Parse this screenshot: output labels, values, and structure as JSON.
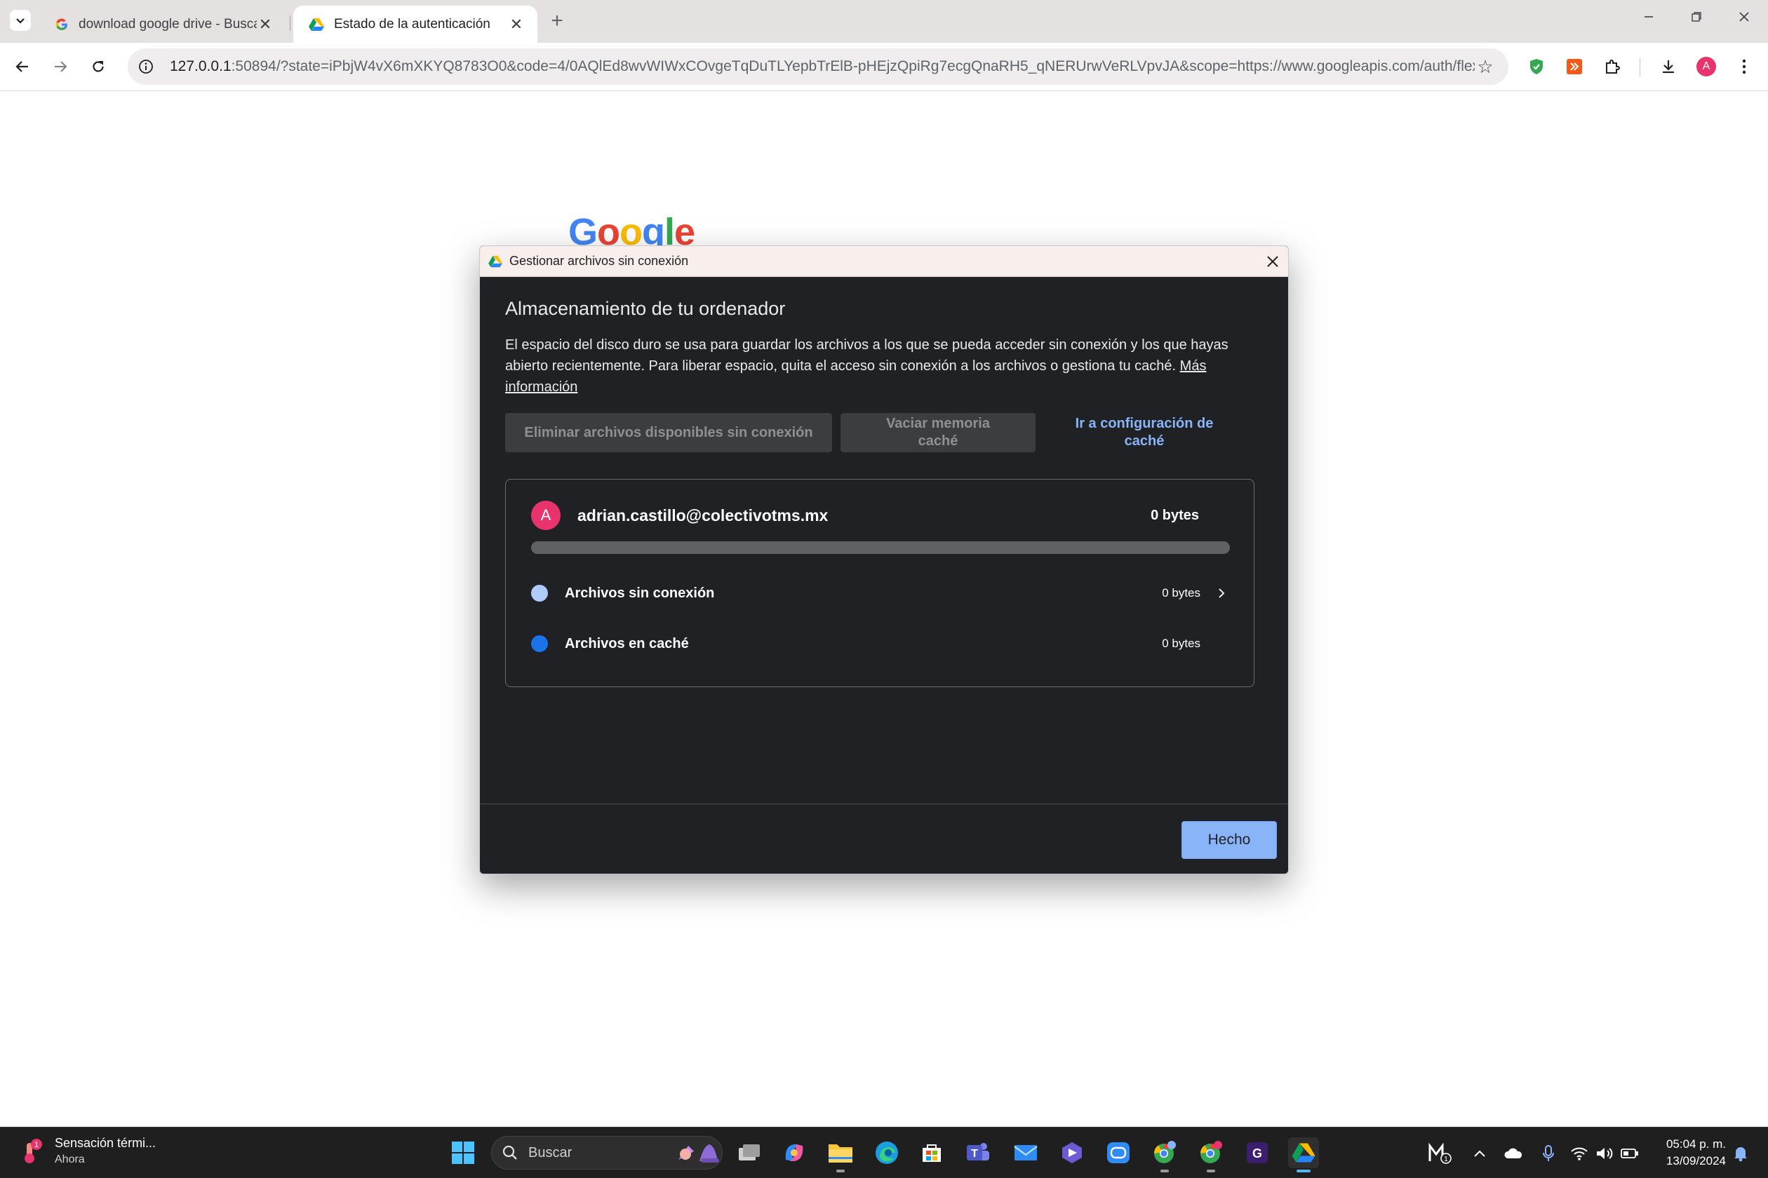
{
  "browser": {
    "tabs": [
      {
        "title": "download google drive - Buscar",
        "active": false
      },
      {
        "title": "Estado de la autenticación",
        "active": true
      }
    ],
    "url_host": "127.0.0.1",
    "url_rest": ":50894/?state=iPbjW4vX6mXKYQ8783O0&code=4/0AQlEd8wvWIWxCOvgeTqDuTLYepbTrElB-pHEjzQpiRg7ecgQnaRH5_qNERUrwVeRLVpvJA&scope=https://www.googleapis.com/auth/flexib...",
    "profile_initial": "A"
  },
  "page": {
    "logo_text": "Google"
  },
  "dialog": {
    "title": "Gestionar archivos sin conexión",
    "heading": "Almacenamiento de tu ordenador",
    "description": "El espacio del disco duro se usa para guardar los archivos a los que se pueda acceder sin conexión y los que hayas abierto recientemente. Para liberar espacio, quita el acceso sin conexión a los archivos o gestiona tu caché.",
    "more_info": "Más información",
    "buttons": {
      "remove_offline": "Eliminar archivos disponibles sin conexión",
      "clear_cache": "Vaciar memoria caché",
      "cache_settings": "Ir a configuración de caché"
    },
    "account": {
      "initial": "A",
      "email": "adrian.castillo@colectivotms.mx",
      "total": "0 bytes",
      "usage_fraction": 0
    },
    "rows": [
      {
        "label": "Archivos sin conexión",
        "size": "0 bytes",
        "color": "#aecbfa"
      },
      {
        "label": "Archivos en caché",
        "size": "0 bytes",
        "color": "#1a73e8"
      }
    ],
    "done": "Hecho"
  },
  "taskbar": {
    "weather_title": "Sensación térmi...",
    "weather_sub": "Ahora",
    "weather_badge": "1",
    "search_placeholder": "Buscar",
    "time": "05:04 p. m.",
    "date": "13/09/2024"
  },
  "colors": {
    "accent": "#8ab4f8",
    "dialog_bg": "#202124",
    "avatar": "#e8336d"
  }
}
